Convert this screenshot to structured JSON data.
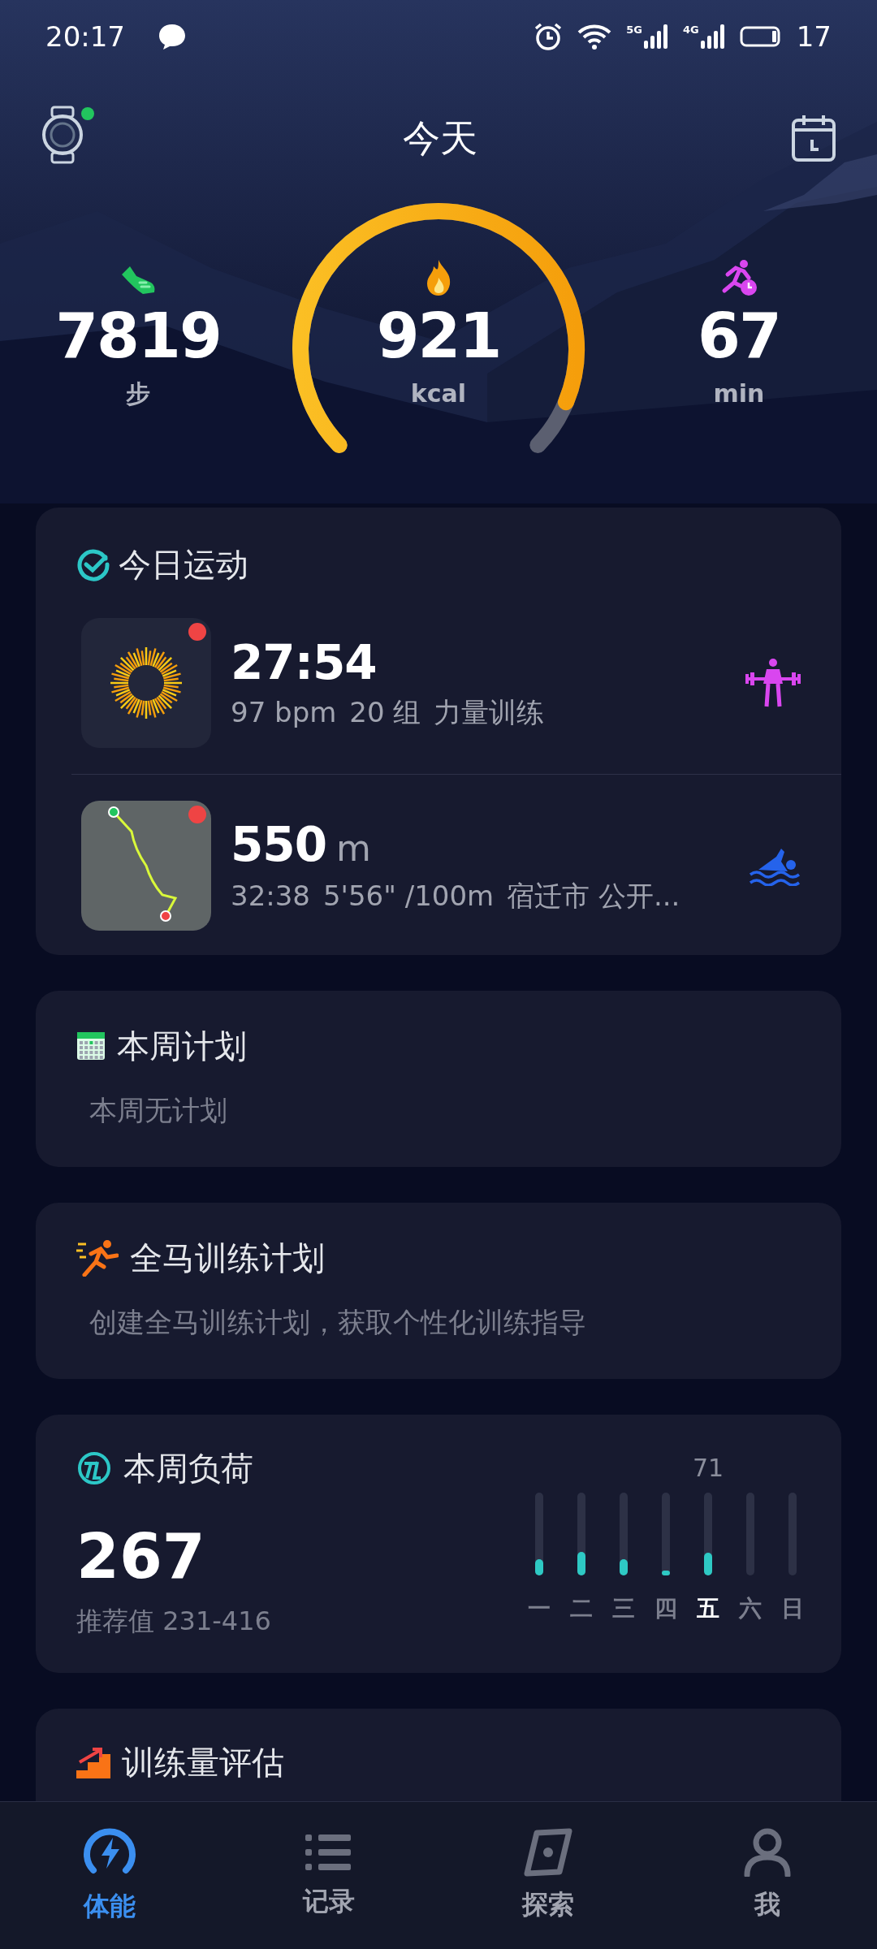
{
  "status_bar": {
    "time": "20:17",
    "signal_labels": [
      "5G",
      "4G"
    ],
    "battery": "17"
  },
  "header": {
    "title": "今天",
    "watch_connected": true
  },
  "summary": {
    "stats": [
      {
        "kind": "steps",
        "value": "7819",
        "unit": "步"
      },
      {
        "kind": "calories",
        "value": "921",
        "unit": "kcal"
      },
      {
        "kind": "minutes",
        "value": "67",
        "unit": "min"
      }
    ]
  },
  "today_workouts": {
    "title": "今日运动",
    "items": [
      {
        "kind": "strength",
        "value": "27:54",
        "details": [
          "97 bpm",
          "20 组",
          "力量训练"
        ],
        "unread": true
      },
      {
        "kind": "swim",
        "value": "550",
        "unit": "m",
        "details": [
          "32:38",
          "5'56\" /100m",
          "宿迁市 公开..."
        ],
        "unread": true
      }
    ]
  },
  "week_plan": {
    "title": "本周计划",
    "text": "本周无计划"
  },
  "marathon_plan": {
    "title": "全马训练计划",
    "text": "创建全马训练计划，获取个性化训练指导"
  },
  "weekly_load": {
    "title": "本周负荷",
    "value": "267",
    "recommended": "推荐值 231-416",
    "days": [
      {
        "label": "一",
        "level": 0.2,
        "selected": false
      },
      {
        "label": "二",
        "level": 0.28,
        "selected": false
      },
      {
        "label": "三",
        "level": 0.2,
        "selected": false
      },
      {
        "label": "四",
        "level": 0.06,
        "selected": false
      },
      {
        "label": "五",
        "level": 0.27,
        "selected": true,
        "value": "71"
      },
      {
        "label": "六",
        "selected": false
      },
      {
        "label": "日",
        "selected": false
      }
    ]
  },
  "training_assessment": {
    "title": "训练量评估"
  },
  "tab_bar": [
    {
      "kind": "fitness",
      "label": "体能",
      "selected": true
    },
    {
      "kind": "records",
      "label": "记录",
      "selected": false
    },
    {
      "kind": "explore",
      "label": "探索",
      "selected": false
    },
    {
      "kind": "me",
      "label": "我",
      "selected": false
    }
  ]
}
